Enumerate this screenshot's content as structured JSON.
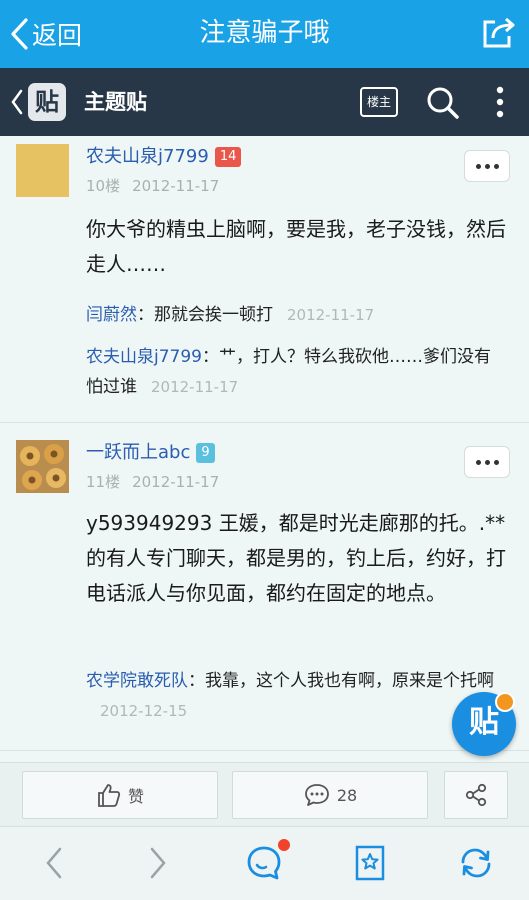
{
  "topbar": {
    "back_label": "返回",
    "title": "注意骗子哦"
  },
  "subbar": {
    "title": "主题贴",
    "logo_text": "贴",
    "louzhu_label": "楼主"
  },
  "posts": [
    {
      "author": "农夫山泉j7799",
      "level": "14",
      "level_color": "#e9564a",
      "floor": "10楼",
      "date": "2012-11-17",
      "content": "你大爷的精虫上脑啊，要是我，老子没钱，然后走人……",
      "replies": [
        {
          "name": "闫蔚然",
          "sep": "：",
          "text": "那就会挨一顿打",
          "date": "2012-11-17"
        },
        {
          "name": "农夫山泉j7799",
          "sep": "：",
          "text": "艹，打人？特么我砍他……爹们没有怕过谁",
          "date": "2012-11-17"
        }
      ]
    },
    {
      "author": "一跃而上abc",
      "level": "9",
      "level_color": "#5bc0de",
      "floor": "11楼",
      "date": "2012-11-17",
      "content": "y593949293 王媛，都是时光走廊那的托。.**的有人专门聊天，都是男的，钓上后，约好，打电话派人与你见面，都约在固定的地点。",
      "replies": [
        {
          "name": "农学院敢死队",
          "sep": "：",
          "text": "我靠，这个人我也有啊，原来是个托啊",
          "date": "2012-12-15"
        }
      ]
    }
  ],
  "fab_label": "贴",
  "actions": {
    "like": "赞",
    "comment_count": "28"
  },
  "colors": {
    "topbar": "#1aa2e6",
    "subbar": "#273747",
    "link": "#2a5db0",
    "background": "#eef6f6"
  }
}
